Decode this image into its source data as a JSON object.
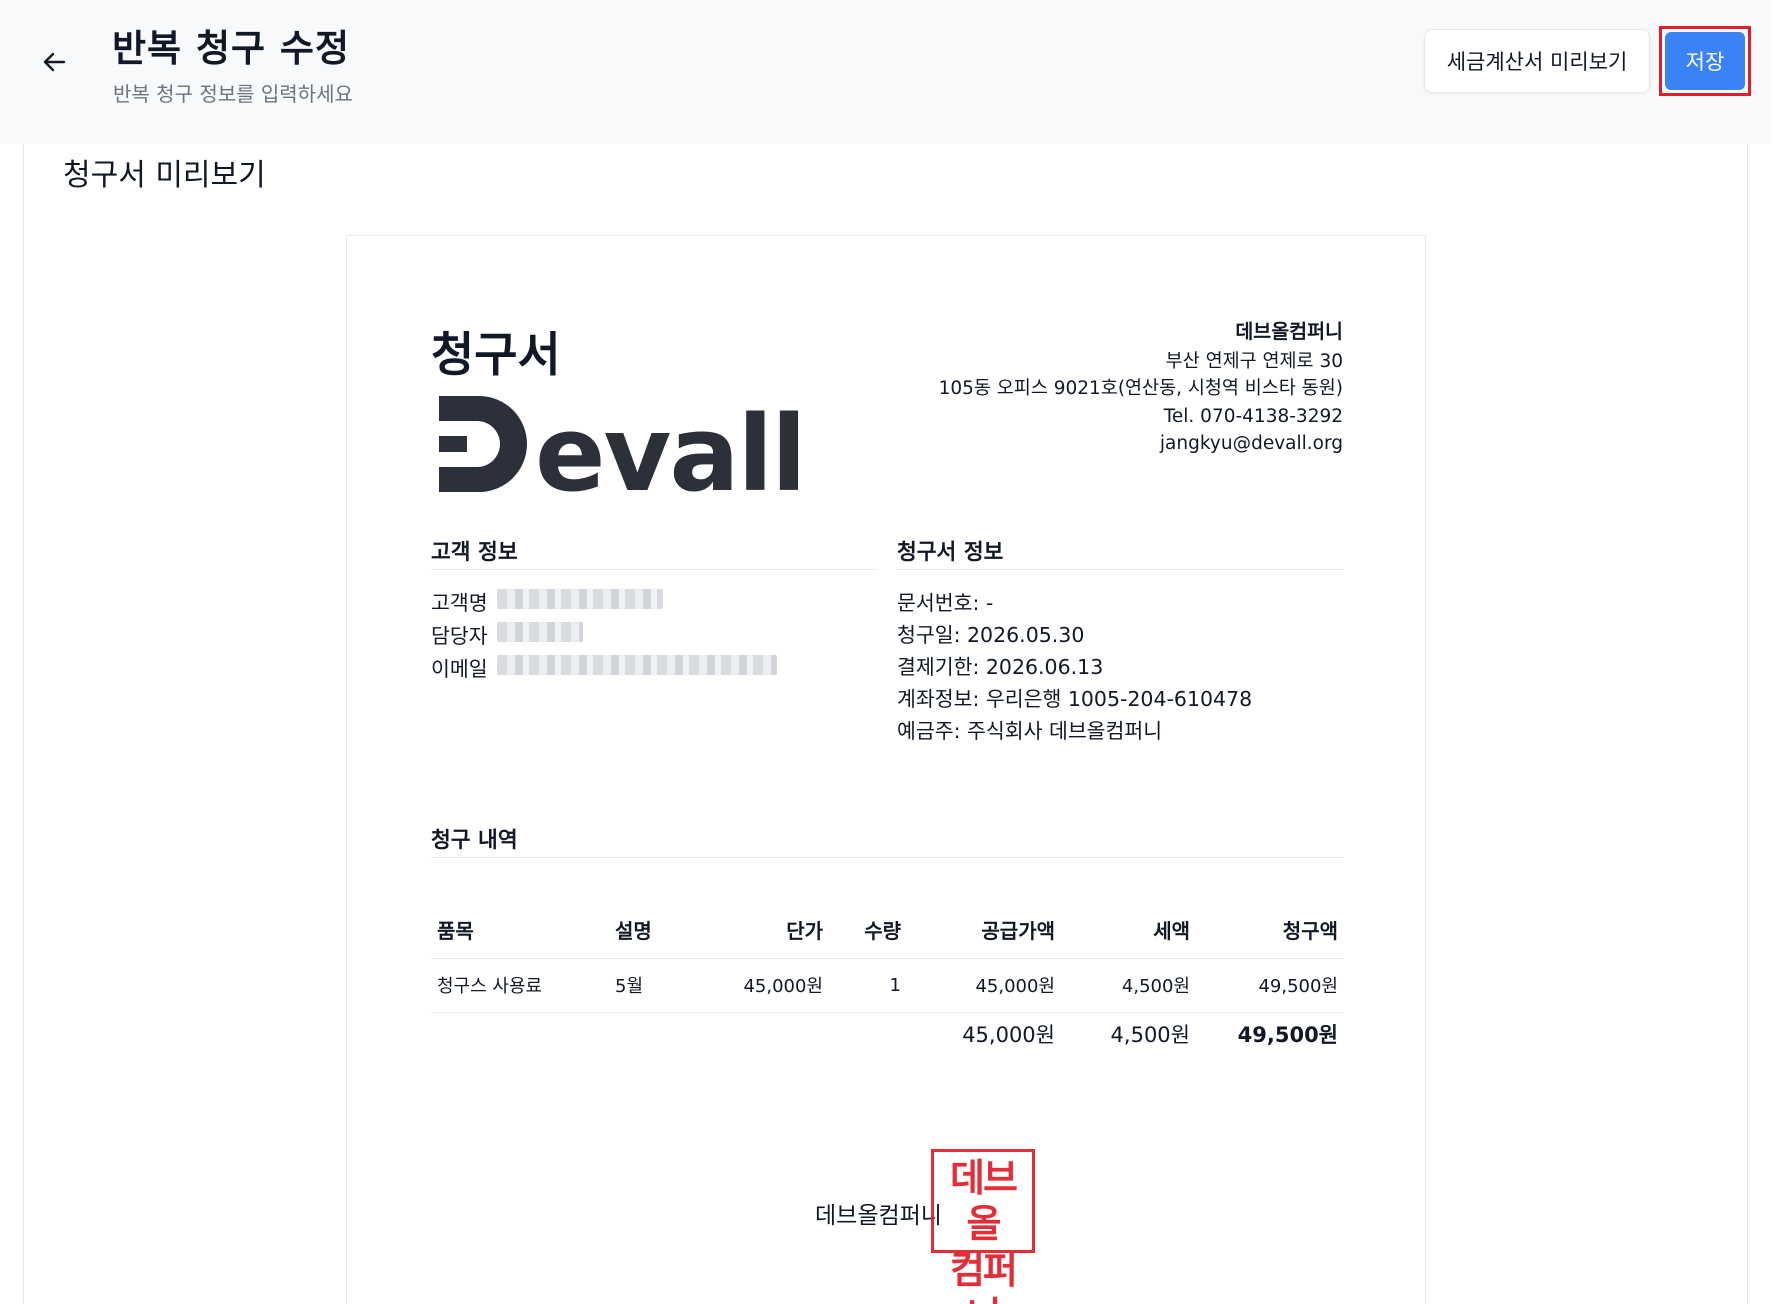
{
  "header": {
    "title": "반복 청구 수정",
    "subtitle": "반복 청구 정보를 입력하세요",
    "preview_label": "세금계산서 미리보기",
    "save_label": "저장"
  },
  "panel": {
    "title": "청구서 미리보기"
  },
  "invoice": {
    "doc_title": "청구서",
    "logo_text": "Devall",
    "company": {
      "name": "데브올컴퍼니",
      "address1": "부산 연제구 연제로 30",
      "address2": "105동 오피스 9021호(연산동, 시청역 비스타 동원)",
      "tel": "Tel. 070-4138-3292",
      "email": "jangkyu@devall.org"
    },
    "customer": {
      "heading": "고객 정보",
      "name_label": "고객명",
      "manager_label": "담당자",
      "email_label": "이메일"
    },
    "info": {
      "heading": "청구서 정보",
      "doc_no": "문서번호: -",
      "issue_date": "청구일: 2026.05.30",
      "due_date": "결제기한: 2026.06.13",
      "account": "계좌정보: 우리은행 1005-204-610478",
      "holder": "예금주: 주식회사 데브올컴퍼니"
    },
    "items_heading": "청구 내역",
    "columns": [
      "품목",
      "설명",
      "단가",
      "수량",
      "공급가액",
      "세액",
      "청구액"
    ],
    "rows": [
      [
        "청구스 사용료",
        "5월",
        "45,000원",
        "1",
        "45,000원",
        "4,500원",
        "49,500원"
      ]
    ],
    "totals": {
      "supply": "45,000원",
      "tax": "4,500원",
      "total": "49,500원"
    },
    "signature": {
      "company": "데브올컴퍼니",
      "stamp_line1": "데브올",
      "stamp_line2": "컴퍼니"
    }
  },
  "colors": {
    "primary": "#3b82f6",
    "highlight": "#e11d2a",
    "text": "#111827",
    "muted": "#6b7280"
  }
}
